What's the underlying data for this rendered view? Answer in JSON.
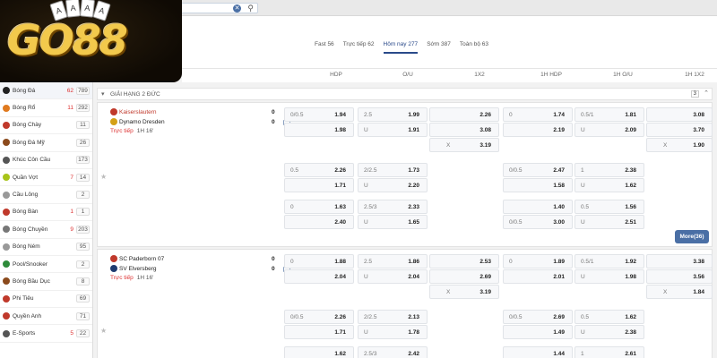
{
  "brand": {
    "logo_text": "GO88",
    "cards": [
      "A",
      "A",
      "A",
      "A"
    ]
  },
  "search": {
    "clear_glyph": "✕",
    "icon": "search-icon"
  },
  "time_tabs": [
    {
      "label": "Fast 56",
      "active": false
    },
    {
      "label": "Trực tiếp 62",
      "active": false
    },
    {
      "label": "Hôm nay 277",
      "active": true
    },
    {
      "label": "Sớm 387",
      "active": false
    },
    {
      "label": "Toàn bộ 63",
      "active": false
    }
  ],
  "columns": [
    "HDP",
    "O/U",
    "1X2",
    "1H HDP",
    "1H O/U",
    "1H 1X2"
  ],
  "sidebar": {
    "items": [
      {
        "label": "Bóng Đá",
        "live": "62",
        "count": "789",
        "icon": "soccer-ball-icon",
        "color": "#222"
      },
      {
        "label": "Bóng Rổ",
        "live": "11",
        "count": "292",
        "icon": "basketball-icon",
        "color": "#e07a1f"
      },
      {
        "label": "Bóng Chày",
        "live": "",
        "count": "11",
        "icon": "baseball-icon",
        "color": "#c0392b"
      },
      {
        "label": "Bóng Đá Mỹ",
        "live": "",
        "count": "26",
        "icon": "american-football-icon",
        "color": "#8b4a1c"
      },
      {
        "label": "Khúc Côn Cầu",
        "live": "",
        "count": "173",
        "icon": "hockey-stick-icon",
        "color": "#555"
      },
      {
        "label": "Quần Vợt",
        "live": "7",
        "count": "14",
        "icon": "tennis-ball-icon",
        "color": "#a8c41a"
      },
      {
        "label": "Cầu Lông",
        "live": "",
        "count": "2",
        "icon": "shuttlecock-icon",
        "color": "#999"
      },
      {
        "label": "Bóng Bàn",
        "live": "1",
        "count": "1",
        "icon": "table-tennis-icon",
        "color": "#c0392b"
      },
      {
        "label": "Bóng Chuyền",
        "live": "9",
        "count": "203",
        "icon": "volleyball-icon",
        "color": "#777"
      },
      {
        "label": "Bóng Ném",
        "live": "",
        "count": "95",
        "icon": "handball-icon",
        "color": "#999"
      },
      {
        "label": "Pool/Snooker",
        "live": "",
        "count": "2",
        "icon": "pool-ball-icon",
        "color": "#2e8b3a"
      },
      {
        "label": "Bóng Bầu Dục",
        "live": "",
        "count": "8",
        "icon": "rugby-ball-icon",
        "color": "#8b4a1c"
      },
      {
        "label": "Phi Tiêu",
        "live": "",
        "count": "69",
        "icon": "dart-icon",
        "color": "#c0392b"
      },
      {
        "label": "Quyền Anh",
        "live": "",
        "count": "71",
        "icon": "boxing-glove-icon",
        "color": "#c0392b"
      },
      {
        "label": "E-Sports",
        "live": "5",
        "count": "22",
        "icon": "esports-icon",
        "color": "#555"
      }
    ]
  },
  "league": {
    "name": "GIẢI HẠNG 2 ĐỨC",
    "count": "3"
  },
  "matches": [
    {
      "home": "Kaiserslautern",
      "away": "Dynamo Dresden",
      "home_score": "0",
      "away_score": "0",
      "live_label": "Trực tiếp",
      "match_time": "1H 16'",
      "rows": [
        [
          [
            "0/0.5",
            "1.94"
          ],
          [
            "2.5",
            "1.99"
          ],
          [
            "",
            "2.26"
          ],
          [
            "0",
            "1.74"
          ],
          [
            "0.5/1",
            "1.81"
          ],
          [
            "",
            "3.08"
          ]
        ],
        [
          [
            "",
            "1.98"
          ],
          [
            "U",
            "1.91"
          ],
          [
            "",
            "3.08"
          ],
          [
            "",
            "2.19"
          ],
          [
            "U",
            "2.09"
          ],
          [
            "",
            "3.70"
          ]
        ],
        [
          null,
          null,
          [
            "X",
            "3.19"
          ],
          null,
          null,
          [
            "X",
            "1.90"
          ]
        ],
        [
          [
            "0.5",
            "2.26"
          ],
          [
            "2/2.5",
            "1.73"
          ],
          null,
          [
            "0/0.5",
            "2.47"
          ],
          [
            "1",
            "2.38"
          ],
          null
        ],
        [
          [
            "",
            "1.71"
          ],
          [
            "U",
            "2.20"
          ],
          null,
          [
            "",
            "1.58"
          ],
          [
            "U",
            "1.62"
          ],
          null
        ],
        [
          [
            "0",
            "1.63"
          ],
          [
            "2.5/3",
            "2.33"
          ],
          null,
          [
            "",
            "1.40"
          ],
          [
            "0.5",
            "1.56"
          ],
          null
        ],
        [
          [
            "",
            "2.40"
          ],
          [
            "U",
            "1.65"
          ],
          null,
          [
            "0/0.5",
            "3.00"
          ],
          [
            "U",
            "2.51"
          ],
          null
        ]
      ],
      "more_label": "More(36)"
    },
    {
      "home": "SC Paderborn 07",
      "away": "SV Elversberg",
      "home_score": "0",
      "away_score": "0",
      "live_label": "Trực tiếp",
      "match_time": "1H 16'",
      "rows": [
        [
          [
            "0",
            "1.88"
          ],
          [
            "2.5",
            "1.86"
          ],
          [
            "",
            "2.53"
          ],
          [
            "0",
            "1.89"
          ],
          [
            "0.5/1",
            "1.92"
          ],
          [
            "",
            "3.38"
          ]
        ],
        [
          [
            "",
            "2.04"
          ],
          [
            "U",
            "2.04"
          ],
          [
            "",
            "2.69"
          ],
          [
            "",
            "2.01"
          ],
          [
            "U",
            "1.98"
          ],
          [
            "",
            "3.56"
          ]
        ],
        [
          null,
          null,
          [
            "X",
            "3.19"
          ],
          null,
          null,
          [
            "X",
            "1.84"
          ]
        ],
        [
          [
            "0/0.5",
            "2.26"
          ],
          [
            "2/2.5",
            "2.13"
          ],
          null,
          [
            "0/0.5",
            "2.69"
          ],
          [
            "0.5",
            "1.62"
          ],
          null
        ],
        [
          [
            "",
            "1.71"
          ],
          [
            "U",
            "1.78"
          ],
          null,
          [
            "",
            "1.49"
          ],
          [
            "U",
            "2.38"
          ],
          null
        ],
        [
          [
            "",
            "1.62"
          ],
          [
            "2.5/3",
            "2.42"
          ],
          null,
          [
            "",
            "1.44"
          ],
          [
            "1",
            "2.61"
          ],
          null
        ]
      ],
      "more_label": ""
    }
  ]
}
